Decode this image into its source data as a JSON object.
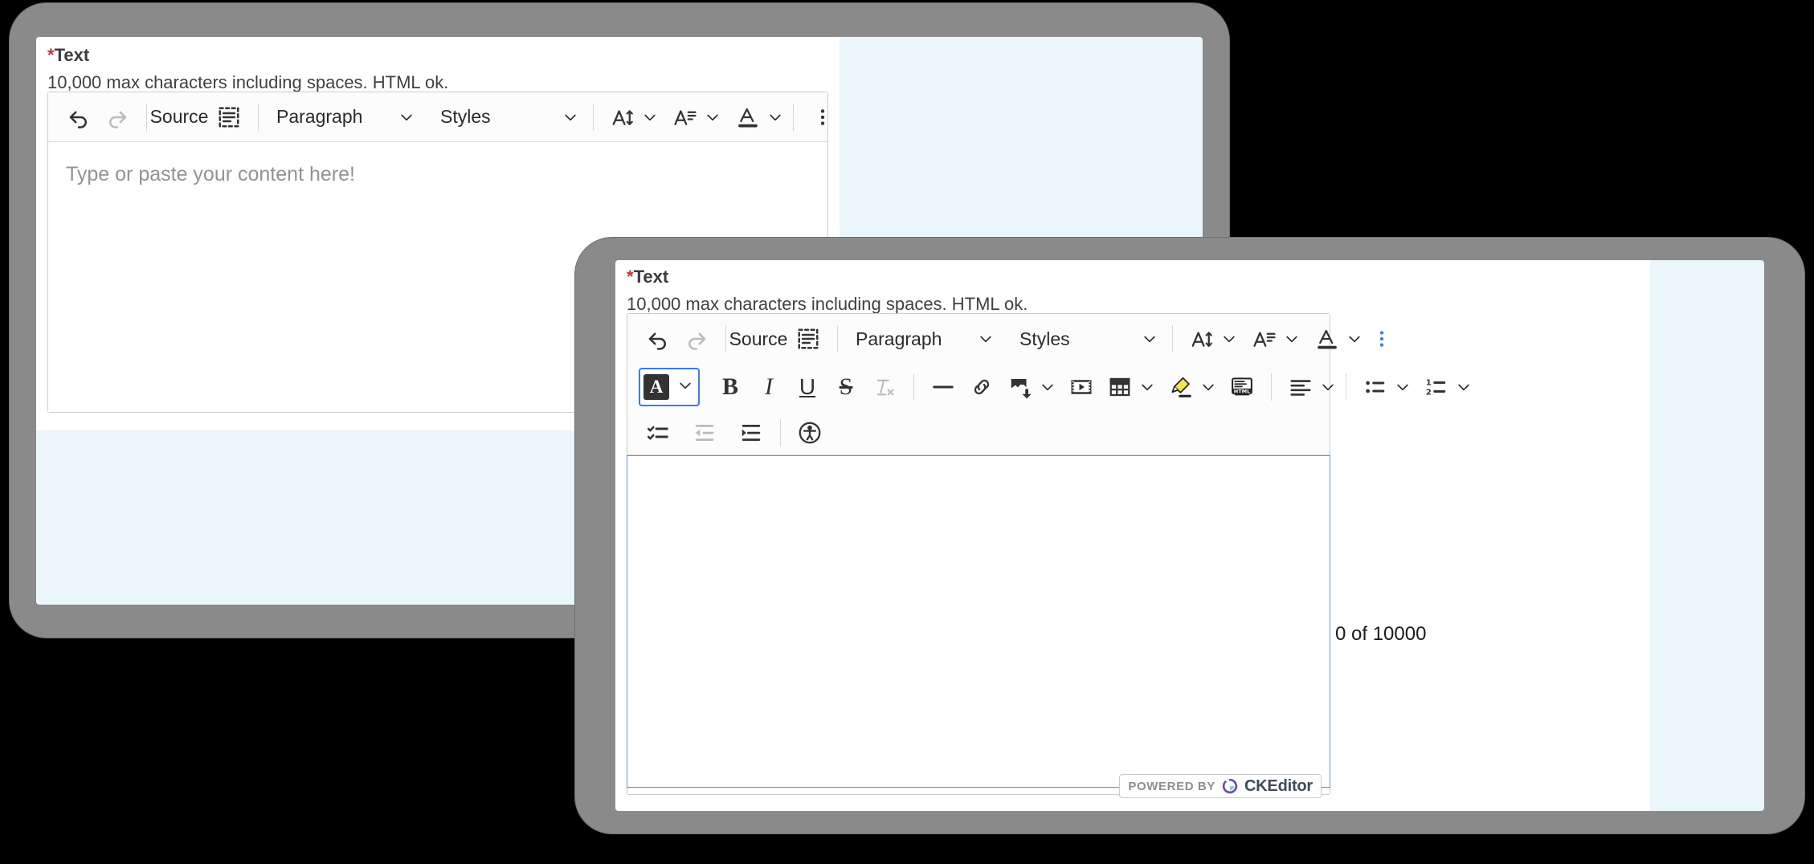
{
  "page": {
    "background": "#000000",
    "bezel_color": "#8a8a8a",
    "screen_tint": "#eaf6fb",
    "accent_focus": "#3b7ddd",
    "required_color": "#d32f2f"
  },
  "editors": [
    {
      "id": "back-editor",
      "label": {
        "required_mark": "*",
        "text": "Text"
      },
      "help_text": "10,000 max characters including spaces. HTML ok.",
      "placeholder": "Type or paste your content here!",
      "toolbar_rows": [
        {
          "items": [
            {
              "name": "undo-icon",
              "kind": "icon",
              "icon": "undo",
              "label": "",
              "disabled": false
            },
            {
              "name": "redo-icon",
              "kind": "icon",
              "icon": "redo",
              "label": "",
              "disabled": true
            },
            {
              "name": "separator",
              "kind": "separator"
            },
            {
              "name": "source-button",
              "kind": "icon-label",
              "icon": "source",
              "label": "Source",
              "disabled": false
            },
            {
              "name": "show-blocks-icon",
              "kind": "icon",
              "icon": "show-blocks",
              "label": "",
              "disabled": false
            },
            {
              "name": "separator",
              "kind": "separator"
            },
            {
              "name": "paragraph-format-dropdown",
              "kind": "dropdown-wide",
              "label": "Paragraph"
            },
            {
              "name": "styles-dropdown",
              "kind": "dropdown-wide",
              "label": "Styles"
            },
            {
              "name": "separator",
              "kind": "separator"
            },
            {
              "name": "font-size-icon",
              "kind": "icon-chevron",
              "icon": "font-size",
              "label": ""
            },
            {
              "name": "font-family-icon",
              "kind": "icon-chevron",
              "icon": "font-family",
              "label": ""
            },
            {
              "name": "font-color-icon",
              "kind": "icon-chevron",
              "icon": "font-color",
              "label": ""
            },
            {
              "name": "spacer",
              "kind": "spacer"
            },
            {
              "name": "separator",
              "kind": "separator"
            },
            {
              "name": "show-more-items-icon",
              "kind": "icon",
              "icon": "kebab",
              "label": "",
              "disabled": false
            }
          ]
        }
      ],
      "counter": ""
    },
    {
      "id": "front-editor",
      "label": {
        "required_mark": "*",
        "text": "Text"
      },
      "help_text": "10,000 max characters including spaces. HTML ok.",
      "placeholder": "",
      "toolbar_rows": [
        {
          "items": [
            {
              "name": "undo-icon",
              "kind": "icon",
              "icon": "undo",
              "label": "",
              "disabled": false
            },
            {
              "name": "redo-icon",
              "kind": "icon",
              "icon": "redo",
              "label": "",
              "disabled": true
            },
            {
              "name": "separator",
              "kind": "separator"
            },
            {
              "name": "source-button",
              "kind": "icon-label",
              "icon": "source",
              "label": "Source",
              "disabled": false
            },
            {
              "name": "show-blocks-icon",
              "kind": "icon",
              "icon": "show-blocks",
              "label": "",
              "disabled": false
            },
            {
              "name": "separator",
              "kind": "separator"
            },
            {
              "name": "paragraph-format-dropdown",
              "kind": "dropdown-wide",
              "label": "Paragraph"
            },
            {
              "name": "styles-dropdown",
              "kind": "dropdown-wide",
              "label": "Styles"
            },
            {
              "name": "separator",
              "kind": "separator"
            },
            {
              "name": "font-size-icon",
              "kind": "icon-chevron",
              "icon": "font-size",
              "label": ""
            },
            {
              "name": "font-family-icon",
              "kind": "icon-chevron",
              "icon": "font-family",
              "label": ""
            },
            {
              "name": "font-color-icon",
              "kind": "icon-chevron",
              "icon": "font-color",
              "label": ""
            },
            {
              "name": "spacer",
              "kind": "spacer"
            },
            {
              "name": "show-fewer-items-icon",
              "kind": "icon",
              "icon": "kebab",
              "label": "",
              "disabled": false,
              "active": true
            }
          ]
        },
        {
          "items": [
            {
              "name": "font-background-color-button",
              "kind": "focused-swatch",
              "label": "A",
              "swatch_color": "#333333",
              "focused": true
            },
            {
              "name": "bold-button",
              "kind": "text-icon",
              "glyph": "B",
              "style": "bold"
            },
            {
              "name": "italic-button",
              "kind": "text-icon",
              "glyph": "I",
              "style": "italic"
            },
            {
              "name": "underline-button",
              "kind": "text-icon",
              "glyph": "U",
              "style": "underline"
            },
            {
              "name": "strikethrough-button",
              "kind": "text-icon",
              "glyph": "S",
              "style": "strike"
            },
            {
              "name": "remove-format-icon",
              "kind": "icon",
              "icon": "remove-format",
              "disabled": true
            },
            {
              "name": "separator",
              "kind": "separator"
            },
            {
              "name": "horizontal-line-icon",
              "kind": "icon",
              "icon": "horizontal-line"
            },
            {
              "name": "link-icon",
              "kind": "icon",
              "icon": "link"
            },
            {
              "name": "insert-image-icon",
              "kind": "icon-chevron",
              "icon": "image"
            },
            {
              "name": "insert-media-icon",
              "kind": "icon",
              "icon": "media"
            },
            {
              "name": "insert-table-icon",
              "kind": "icon-chevron",
              "icon": "table"
            },
            {
              "name": "highlight-icon",
              "kind": "icon-chevron",
              "icon": "highlight"
            },
            {
              "name": "html-embed-icon",
              "kind": "icon",
              "icon": "html-embed"
            },
            {
              "name": "separator",
              "kind": "separator"
            },
            {
              "name": "text-alignment-icon",
              "kind": "icon-chevron",
              "icon": "align"
            },
            {
              "name": "separator",
              "kind": "separator"
            },
            {
              "name": "bulleted-list-icon",
              "kind": "icon-chevron",
              "icon": "bulleted-list"
            },
            {
              "name": "numbered-list-icon",
              "kind": "icon-chevron",
              "icon": "numbered-list"
            }
          ]
        },
        {
          "items": [
            {
              "name": "todo-list-icon",
              "kind": "icon",
              "icon": "todo-list"
            },
            {
              "name": "decrease-indent-icon",
              "kind": "icon",
              "icon": "outdent",
              "disabled": true
            },
            {
              "name": "increase-indent-icon",
              "kind": "icon",
              "icon": "indent"
            },
            {
              "name": "separator",
              "kind": "separator"
            },
            {
              "name": "accessibility-help-icon",
              "kind": "icon",
              "icon": "accessibility"
            }
          ]
        }
      ],
      "counter": "0 of 10000",
      "badge": {
        "powered_by": "POWERED BY",
        "brand": "CKEditor",
        "logo_color": "#6c4bb6"
      }
    }
  ]
}
